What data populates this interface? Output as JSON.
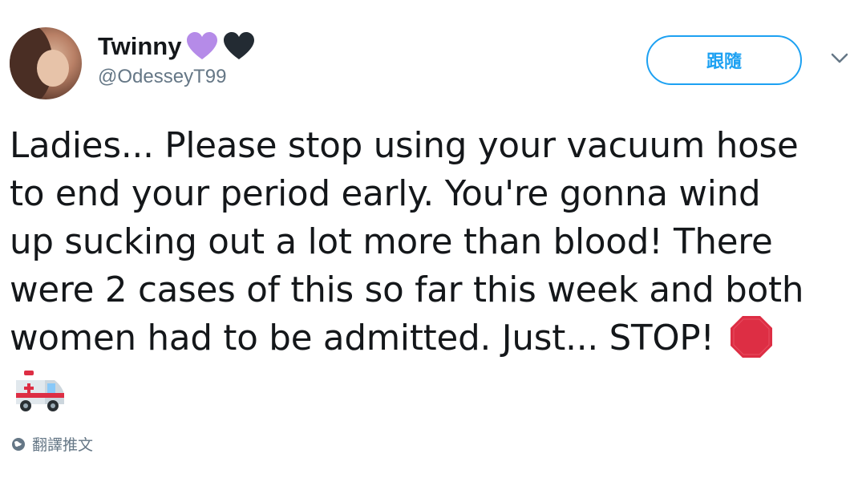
{
  "user": {
    "display_name": "Twinny",
    "handle": "@OdesseyT99",
    "badges": [
      "purple-heart-icon",
      "black-heart-icon"
    ]
  },
  "follow_button": {
    "label": "跟隨"
  },
  "tweet": {
    "lines": [
      "Ladies... Please stop using your vacuum hose",
      "to end your period early. You're gonna wind",
      "up sucking out a lot more than blood! There",
      "were 2 cases of this so far this week and both",
      "women had to be admitted. Just... STOP!"
    ],
    "emojis": [
      "stop-sign-icon",
      "ambulance-icon"
    ]
  },
  "translate": {
    "label": "翻譯推文",
    "icon": "globe-icon"
  },
  "colors": {
    "accent": "#1da1f2",
    "text": "#14171a",
    "secondary": "#657786",
    "purple_heart": "#b58be8",
    "black_heart": "#232b33",
    "stop_red": "#dd2e44"
  }
}
